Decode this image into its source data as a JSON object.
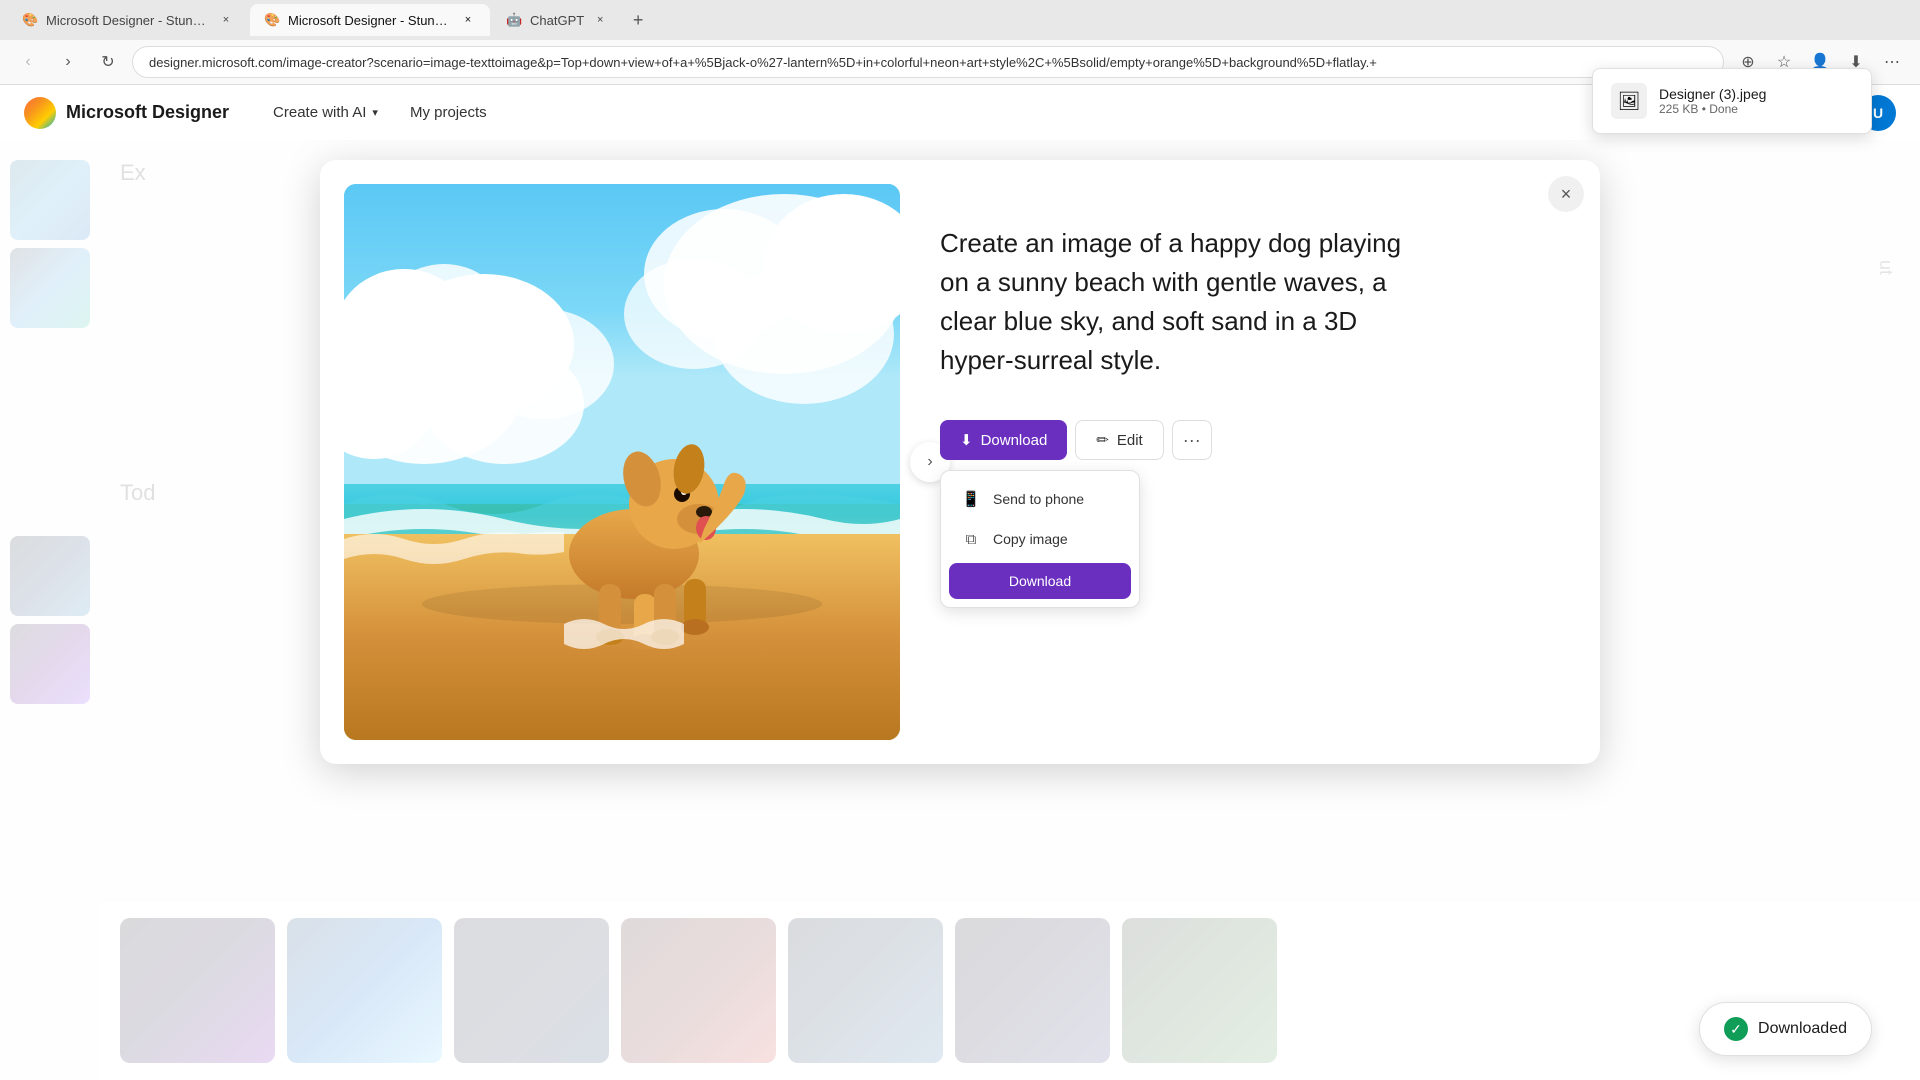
{
  "browser": {
    "tabs": [
      {
        "id": "tab1",
        "title": "Microsoft Designer - Stunning",
        "favicon": "🎨",
        "active": false
      },
      {
        "id": "tab2",
        "title": "Microsoft Designer - Stunning",
        "favicon": "🎨",
        "active": true
      },
      {
        "id": "tab3",
        "title": "ChatGPT",
        "favicon": "🤖",
        "active": false
      }
    ],
    "address": "designer.microsoft.com/image-creator?scenario=image-texttoimage&p=Top+down+view+of+a+%5Bjack-o%27-lantern%5D+in+colorful+neon+art+style%2C+%5Bsolid/empty+orange%5D+background%5D+flatlay.+"
  },
  "header": {
    "logo_text": "Microsoft Designer",
    "nav_items": [
      {
        "id": "create-ai",
        "label": "Create with AI",
        "has_chevron": true
      },
      {
        "id": "my-projects",
        "label": "My projects",
        "has_chevron": false
      }
    ]
  },
  "page": {
    "explore_label": "Ex",
    "today_label": "Tod",
    "about_label": "ut"
  },
  "modal": {
    "description": "Create an image of a happy dog playing on a sunny beach with gentle waves, a clear blue sky, and soft sand in a 3D hyper-surreal style.",
    "close_label": "×",
    "download_label": "Download",
    "edit_label": "Edit",
    "more_label": "···",
    "dropdown": {
      "send_to_phone_label": "Send to phone",
      "copy_image_label": "Copy image",
      "download_label": "Download"
    }
  },
  "download_notification": {
    "filename": "Designer (3).jpeg",
    "size": "225 KB",
    "status": "Done"
  },
  "downloaded_toast": {
    "label": "Downloaded"
  },
  "icons": {
    "download": "⬇",
    "edit": "✏",
    "next": "›",
    "close": "×",
    "phone": "📱",
    "copy": "⧉",
    "file": "🖼",
    "check": "✓"
  }
}
